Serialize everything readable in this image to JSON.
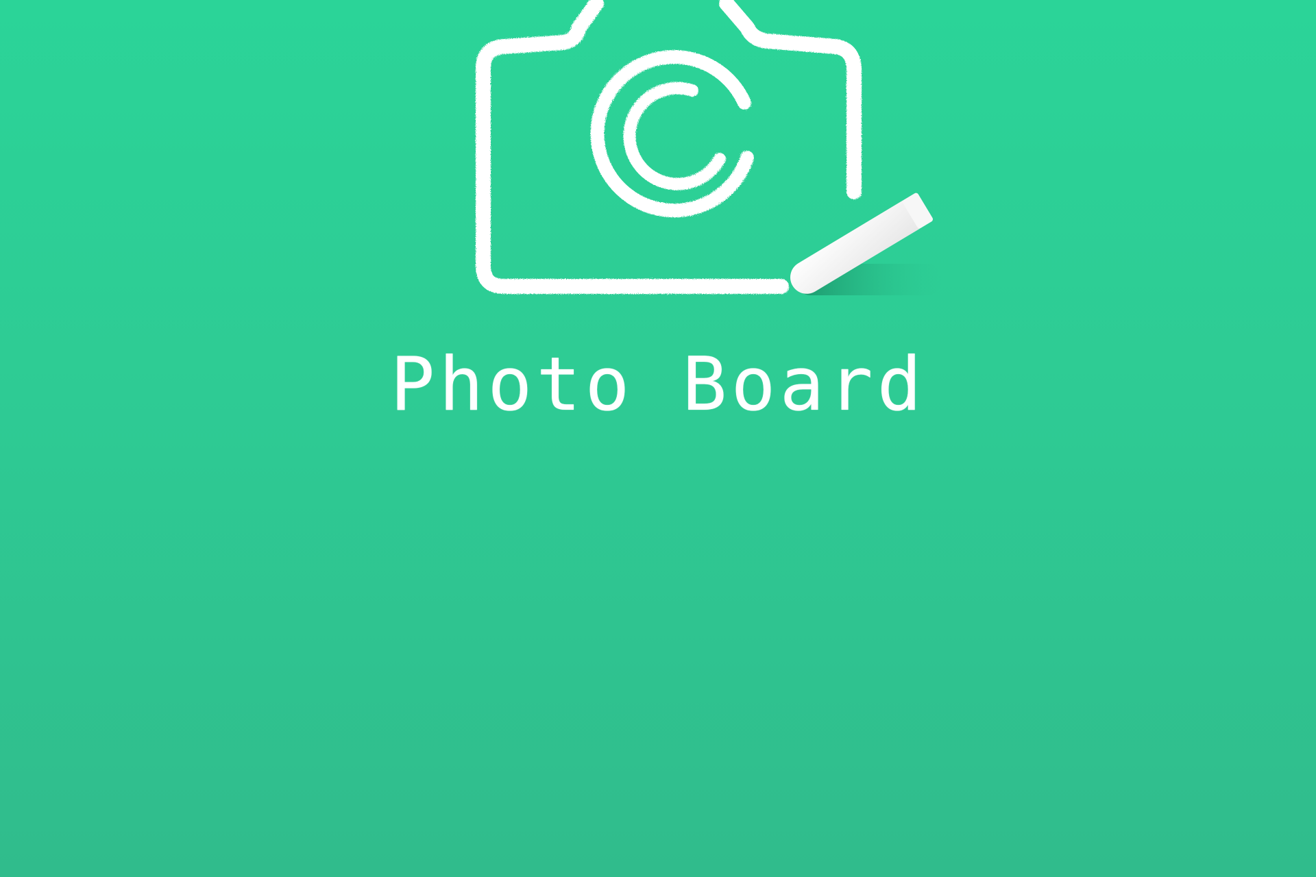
{
  "app": {
    "title": "Photo Board"
  },
  "logo": {
    "icon": "chalk-camera-icon",
    "chalk_icon": "chalk-stick-icon"
  },
  "colors": {
    "background_top": "#2bd498",
    "background_bottom": "#30bc8c",
    "chalk": "#ffffff"
  }
}
